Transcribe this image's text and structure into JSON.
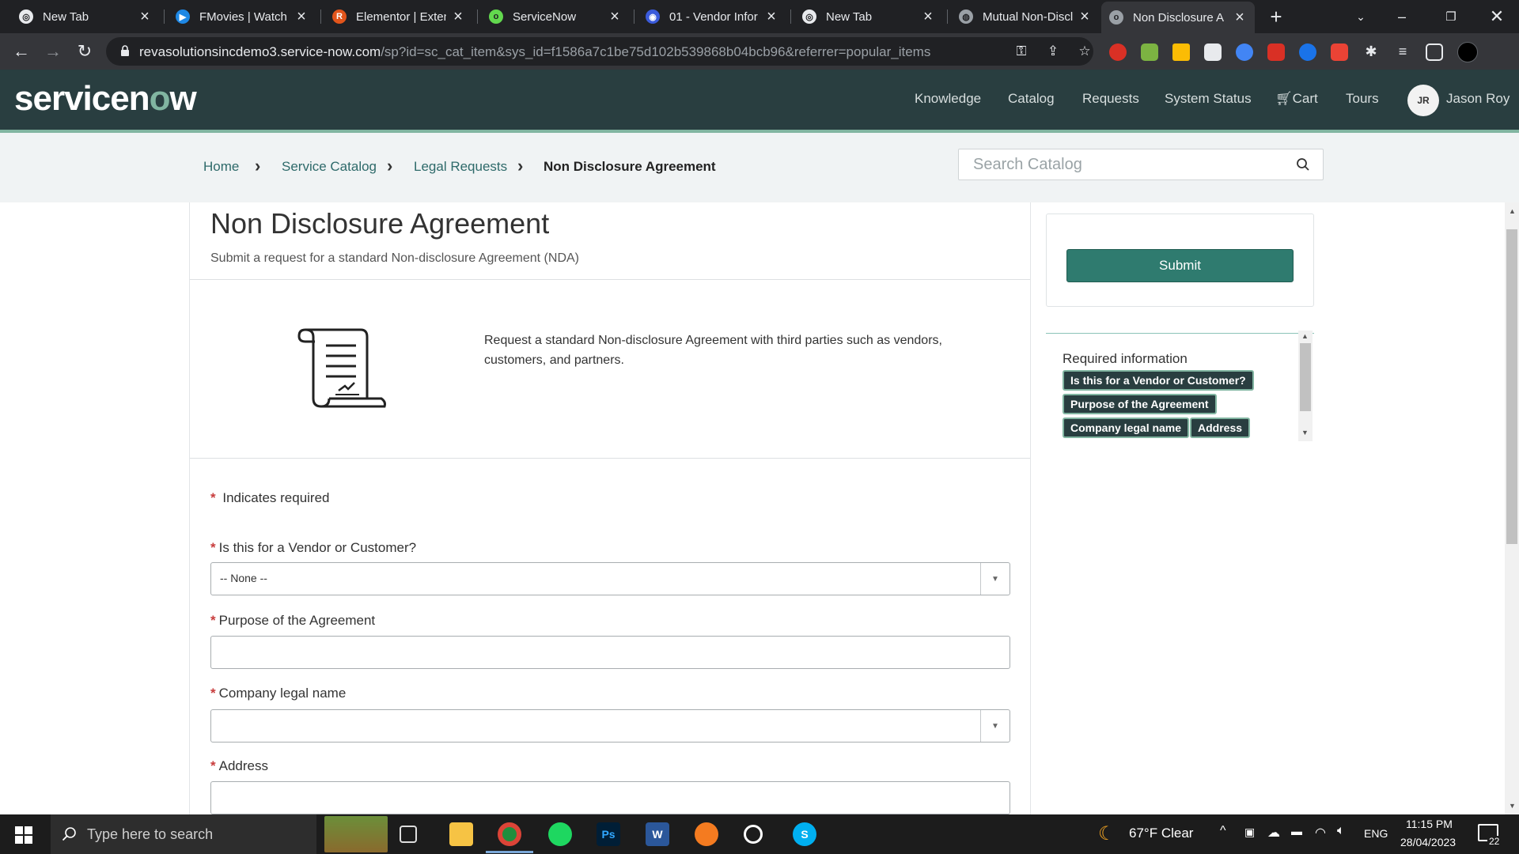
{
  "browser": {
    "tabs": [
      {
        "title": "New Tab",
        "active": false
      },
      {
        "title": "FMovies | Watch T",
        "active": false
      },
      {
        "title": "Elementor | Exten",
        "active": false
      },
      {
        "title": "ServiceNow",
        "active": false
      },
      {
        "title": "01 - Vendor Infor",
        "active": false
      },
      {
        "title": "New Tab",
        "active": false
      },
      {
        "title": "Mutual Non-Discl",
        "active": false
      },
      {
        "title": "Non Disclosure A",
        "active": true
      }
    ],
    "new_tab_symbol": "+",
    "url_host": "revasolutionsincdemo3.service-now.com",
    "url_path": "/sp?id=sc_cat_item&sys_id=f1586a7c1be75d102b539868b04bcb96&referrer=popular_items"
  },
  "header": {
    "logo_pre": "servicen",
    "logo_o": "o",
    "logo_post": "w",
    "nav": [
      "Knowledge",
      "Catalog",
      "Requests",
      "System Status",
      "Cart",
      "Tours"
    ],
    "user_initials": "JR",
    "user_name": "Jason Roy"
  },
  "breadcrumb": {
    "items": [
      "Home",
      "Service Catalog",
      "Legal Requests"
    ],
    "current": "Non Disclosure Agreement"
  },
  "search": {
    "placeholder": "Search Catalog"
  },
  "item": {
    "title": "Non Disclosure Agreement",
    "subtitle": "Submit a request for a standard Non-disclosure Agreement (NDA)",
    "description": "Request a standard Non-disclosure Agreement with third parties such as vendors, customers, and partners."
  },
  "form": {
    "required_note": "Indicates required",
    "required_star": "*",
    "fields": [
      {
        "label": "Is this for a Vendor or Customer?",
        "type": "select",
        "value": "-- None --"
      },
      {
        "label": "Purpose of the Agreement",
        "type": "text",
        "value": ""
      },
      {
        "label": "Company legal name",
        "type": "select",
        "value": ""
      },
      {
        "label": "Address",
        "type": "text",
        "value": ""
      }
    ]
  },
  "sidebar": {
    "submit_label": "Submit",
    "required_title": "Required information",
    "required_chips": [
      "Is this for a Vendor or Customer?",
      "Purpose of the Agreement",
      "Company legal name",
      "Address"
    ]
  },
  "taskbar": {
    "search_placeholder": "Type here to search",
    "weather": "67°F  Clear",
    "language": "ENG",
    "time": "11:15 PM",
    "date": "28/04/2023",
    "notification_count": "22"
  },
  "colors": {
    "header_bg": "#293e40",
    "accent": "#81b5a1",
    "submit_bg": "#2f7b6f",
    "link": "#2e6a6a",
    "required": "#c83c3c"
  },
  "icons": [
    "chrome-icon",
    "lock-icon",
    "key-icon",
    "share-icon",
    "star-icon",
    "cart-icon",
    "search-icon",
    "contract-document-icon",
    "windows-start-icon",
    "weather-moon-icon"
  ]
}
